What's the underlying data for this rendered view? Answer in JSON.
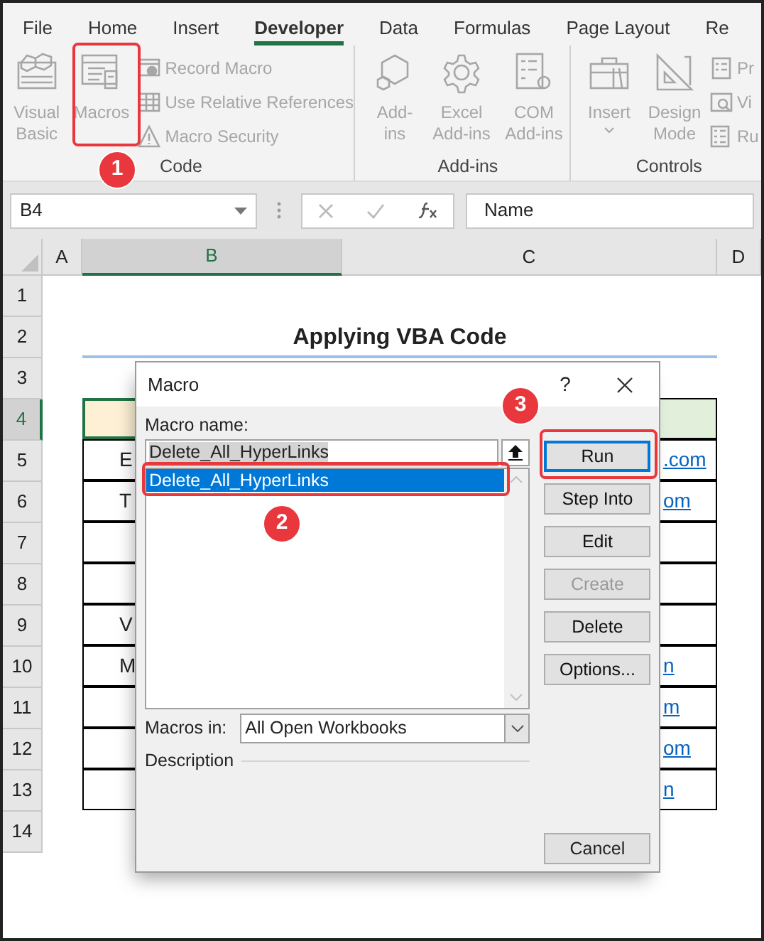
{
  "ribbon_tabs": [
    {
      "label": "File",
      "selected": false
    },
    {
      "label": "Home",
      "selected": false
    },
    {
      "label": "Insert",
      "selected": false
    },
    {
      "label": "Developer",
      "selected": true
    },
    {
      "label": "Data",
      "selected": false
    },
    {
      "label": "Formulas",
      "selected": false
    },
    {
      "label": "Page Layout",
      "selected": false
    },
    {
      "label": "Re",
      "selected": false
    }
  ],
  "ribbon_groups": [
    {
      "label": "Code",
      "large": [
        {
          "lines": [
            "Visual",
            "Basic"
          ]
        },
        {
          "lines": [
            "Macros"
          ]
        }
      ],
      "small": [
        {
          "label": "Record Macro"
        },
        {
          "label": "Use Relative References"
        },
        {
          "label": "Macro Security"
        }
      ]
    },
    {
      "label": "Add-ins",
      "large": [
        {
          "lines": [
            "Add-",
            "ins"
          ]
        },
        {
          "lines": [
            "Excel",
            "Add-ins"
          ]
        },
        {
          "lines": [
            "COM",
            "Add-ins"
          ]
        }
      ]
    },
    {
      "label": "Controls",
      "large": [
        {
          "lines": [
            "Insert"
          ],
          "dropdown": true
        },
        {
          "lines": [
            "Design",
            "Mode"
          ]
        }
      ],
      "small": [
        {
          "label": "Pr"
        },
        {
          "label": "Vi"
        },
        {
          "label": "Ru"
        }
      ]
    }
  ],
  "name_box": "B4",
  "formula": "Name",
  "columns": [
    {
      "label": "A",
      "selected": false
    },
    {
      "label": "B",
      "selected": true
    },
    {
      "label": "C",
      "selected": false
    },
    {
      "label": "D",
      "selected": false
    }
  ],
  "rows": [
    {
      "header": "1",
      "kind": "blank",
      "selected": false
    },
    {
      "header": "2",
      "kind": "title",
      "selected": false,
      "title": "Applying VBA Code"
    },
    {
      "header": "3",
      "kind": "blank",
      "selected": false
    },
    {
      "header": "4",
      "kind": "header",
      "selected": true
    },
    {
      "header": "5",
      "kind": "data",
      "selected": false,
      "b": "E",
      "c": ".com"
    },
    {
      "header": "6",
      "kind": "data",
      "selected": false,
      "b": "T",
      "c": "om"
    },
    {
      "header": "7",
      "kind": "data",
      "selected": false
    },
    {
      "header": "8",
      "kind": "data",
      "selected": false
    },
    {
      "header": "9",
      "kind": "data",
      "selected": false,
      "b": "V"
    },
    {
      "header": "10",
      "kind": "data",
      "selected": false,
      "b": "M",
      "c": "n"
    },
    {
      "header": "11",
      "kind": "data",
      "selected": false,
      "c": "m"
    },
    {
      "header": "12",
      "kind": "data",
      "selected": false,
      "c": "om"
    },
    {
      "header": "13",
      "kind": "data",
      "selected": false,
      "c": "n"
    },
    {
      "header": "14",
      "kind": "blank",
      "selected": false
    }
  ],
  "dialog": {
    "title": "Macro",
    "help": "?",
    "name_label": "Macro name:",
    "name_value": "Delete_All_HyperLinks",
    "macros": [
      {
        "name": "Delete_All_HyperLinks",
        "selected": true
      }
    ],
    "buttons": [
      {
        "label": "Run",
        "default": true,
        "disabled": false
      },
      {
        "label": "Step Into",
        "default": false,
        "disabled": false
      },
      {
        "label": "Edit",
        "default": false,
        "disabled": false
      },
      {
        "label": "Create",
        "default": false,
        "disabled": true
      },
      {
        "label": "Delete",
        "default": false,
        "disabled": false
      },
      {
        "label": "Options...",
        "default": false,
        "disabled": false
      }
    ],
    "macros_in_label": "Macros in:",
    "macros_in_value": "All Open Workbooks",
    "description_label": "Description",
    "cancel": "Cancel"
  },
  "annotations": [
    {
      "number": "1"
    },
    {
      "number": "2"
    },
    {
      "number": "3"
    }
  ]
}
